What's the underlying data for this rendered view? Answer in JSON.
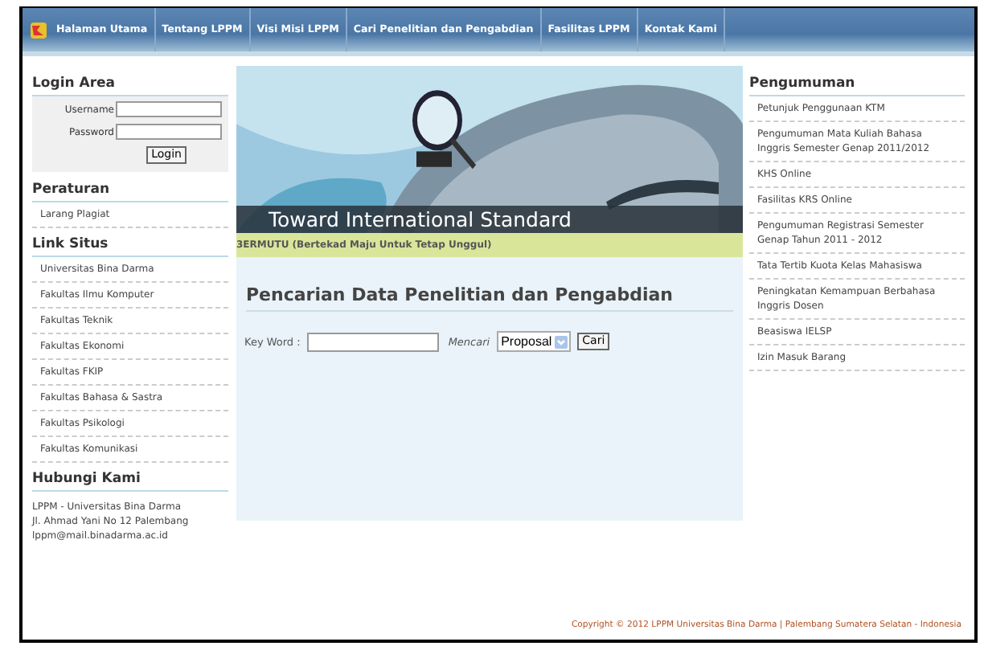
{
  "nav": {
    "items": [
      "Halaman Utama",
      "Tentang LPPM",
      "Visi Misi LPPM",
      "Cari Penelitian dan Pengabdian",
      "Fasilitas LPPM",
      "Kontak Kami"
    ]
  },
  "login": {
    "title": "Login Area",
    "username_label": "Username",
    "password_label": "Password",
    "button": "Login"
  },
  "peraturan": {
    "title": "Peraturan",
    "items": [
      "Larang Plagiat"
    ]
  },
  "links": {
    "title": "Link Situs",
    "items": [
      "Universitas Bina Darma",
      "Fakultas Ilmu Komputer",
      "Fakultas Teknik",
      "Fakultas Ekonomi",
      "Fakultas FKIP",
      "Fakultas Bahasa & Sastra",
      "Fakultas Psikologi",
      "Fakultas Komunikasi"
    ]
  },
  "contact": {
    "title": "Hubungi Kami",
    "lines": [
      "LPPM - Universitas Bina Darma",
      "Jl. Ahmad Yani No 12 Palembang",
      "lppm@mail.binadarma.ac.id"
    ]
  },
  "banner": {
    "kind": "picture",
    "caption": "Toward International Standard",
    "marquee": "3ERMUTU (Bertekad Maju Untuk Tetap Unggul)"
  },
  "search": {
    "title": "Pencarian Data Penelitian dan Pengabdian",
    "keyword_label": "Key Word :",
    "mencari_label": "Mencari",
    "select_value": "Proposal",
    "button": "Cari"
  },
  "announcements": {
    "title": "Pengumuman",
    "items": [
      "Petunjuk Penggunaan KTM",
      "Pengumuman Mata Kuliah Bahasa Inggris Semester Genap 2011/2012",
      "KHS Online",
      "Fasilitas KRS Online",
      "Pengumuman Registrasi Semester Genap Tahun 2011 - 2012",
      "Tata Tertib Kuota Kelas Mahasiswa",
      "Peningkatan Kemampuan Berbahasa Inggris Dosen",
      "Beasiswa IELSP",
      "Izin Masuk Barang"
    ]
  },
  "footer": "Copyright © 2012 LPPM Universitas Bina Darma | Palembang Sumatera Selatan - Indonesia"
}
